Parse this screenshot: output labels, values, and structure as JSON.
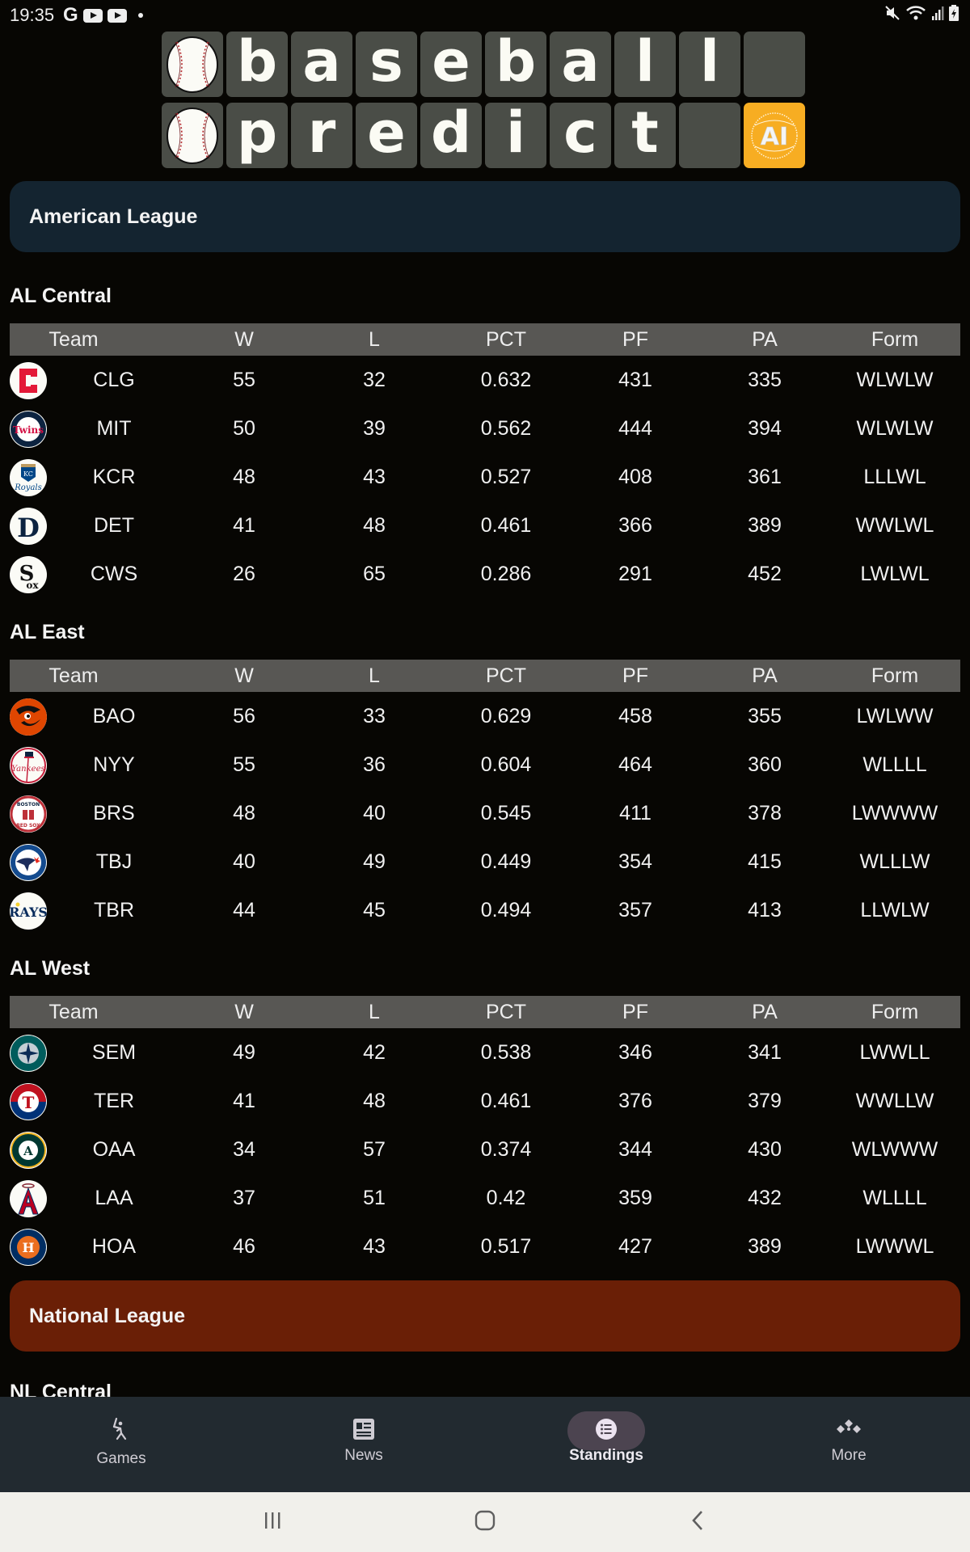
{
  "status_bar": {
    "time": "19:35",
    "left_icons": [
      "google-icon",
      "youtube-icon",
      "youtube-icon",
      "notification-dot-icon"
    ],
    "right_icons": [
      "mute-icon",
      "wifi-icon",
      "cell-signal-icon",
      "battery-charging-icon"
    ]
  },
  "logo": {
    "row1": [
      "baseball",
      "b",
      "a",
      "s",
      "e",
      "b",
      "a",
      "l",
      "l",
      ""
    ],
    "row2": [
      "baseball",
      "p",
      "r",
      "e",
      "d",
      "i",
      "c",
      "t",
      "",
      "AI"
    ],
    "ai_badge": "AI"
  },
  "leagues": [
    {
      "name": "American League",
      "color": "#142430",
      "divisions": [
        {
          "name": "AL Central",
          "columns": [
            "Team",
            "W",
            "L",
            "PCT",
            "PF",
            "PA",
            "Form"
          ],
          "rows": [
            {
              "logo": "cleveland-guardians-logo",
              "team": "CLG",
              "w": "55",
              "l": "32",
              "pct": "0.632",
              "pf": "431",
              "pa": "335",
              "form": "WLWLW"
            },
            {
              "logo": "minnesota-twins-logo",
              "team": "MIT",
              "w": "50",
              "l": "39",
              "pct": "0.562",
              "pf": "444",
              "pa": "394",
              "form": "WLWLW"
            },
            {
              "logo": "kansas-city-royals-logo",
              "team": "KCR",
              "w": "48",
              "l": "43",
              "pct": "0.527",
              "pf": "408",
              "pa": "361",
              "form": "LLLWL"
            },
            {
              "logo": "detroit-tigers-logo",
              "team": "DET",
              "w": "41",
              "l": "48",
              "pct": "0.461",
              "pf": "366",
              "pa": "389",
              "form": "WWLWL"
            },
            {
              "logo": "chicago-white-sox-logo",
              "team": "CWS",
              "w": "26",
              "l": "65",
              "pct": "0.286",
              "pf": "291",
              "pa": "452",
              "form": "LWLWL"
            }
          ]
        },
        {
          "name": "AL East",
          "columns": [
            "Team",
            "W",
            "L",
            "PCT",
            "PF",
            "PA",
            "Form"
          ],
          "rows": [
            {
              "logo": "baltimore-orioles-logo",
              "team": "BAO",
              "w": "56",
              "l": "33",
              "pct": "0.629",
              "pf": "458",
              "pa": "355",
              "form": "LWLWW"
            },
            {
              "logo": "new-york-yankees-logo",
              "team": "NYY",
              "w": "55",
              "l": "36",
              "pct": "0.604",
              "pf": "464",
              "pa": "360",
              "form": "WLLLL"
            },
            {
              "logo": "boston-red-sox-logo",
              "team": "BRS",
              "w": "48",
              "l": "40",
              "pct": "0.545",
              "pf": "411",
              "pa": "378",
              "form": "LWWWW"
            },
            {
              "logo": "toronto-blue-jays-logo",
              "team": "TBJ",
              "w": "40",
              "l": "49",
              "pct": "0.449",
              "pf": "354",
              "pa": "415",
              "form": "WLLLW"
            },
            {
              "logo": "tampa-bay-rays-logo",
              "team": "TBR",
              "w": "44",
              "l": "45",
              "pct": "0.494",
              "pf": "357",
              "pa": "413",
              "form": "LLWLW"
            }
          ]
        },
        {
          "name": "AL West",
          "columns": [
            "Team",
            "W",
            "L",
            "PCT",
            "PF",
            "PA",
            "Form"
          ],
          "rows": [
            {
              "logo": "seattle-mariners-logo",
              "team": "SEM",
              "w": "49",
              "l": "42",
              "pct": "0.538",
              "pf": "346",
              "pa": "341",
              "form": "LWWLL"
            },
            {
              "logo": "texas-rangers-logo",
              "team": "TER",
              "w": "41",
              "l": "48",
              "pct": "0.461",
              "pf": "376",
              "pa": "379",
              "form": "WWLLW"
            },
            {
              "logo": "oakland-athletics-logo",
              "team": "OAA",
              "w": "34",
              "l": "57",
              "pct": "0.374",
              "pf": "344",
              "pa": "430",
              "form": "WLWWW"
            },
            {
              "logo": "los-angeles-angels-logo",
              "team": "LAA",
              "w": "37",
              "l": "51",
              "pct": "0.42",
              "pf": "359",
              "pa": "432",
              "form": "WLLLL"
            },
            {
              "logo": "houston-astros-logo",
              "team": "HOA",
              "w": "46",
              "l": "43",
              "pct": "0.517",
              "pf": "427",
              "pa": "389",
              "form": "LWWWL"
            }
          ]
        }
      ]
    },
    {
      "name": "National League",
      "color": "#6a1f06",
      "divisions": [
        {
          "name": "NL Central"
        }
      ]
    }
  ],
  "bottom_nav": {
    "active": "Standings",
    "items": [
      {
        "label": "Games",
        "icon": "batter-icon"
      },
      {
        "label": "News",
        "icon": "newspaper-icon"
      },
      {
        "label": "Standings",
        "icon": "list-icon"
      },
      {
        "label": "More",
        "icon": "more-diamond-icon"
      }
    ]
  },
  "system_nav": [
    "recent-apps-icon",
    "home-icon",
    "back-icon"
  ]
}
